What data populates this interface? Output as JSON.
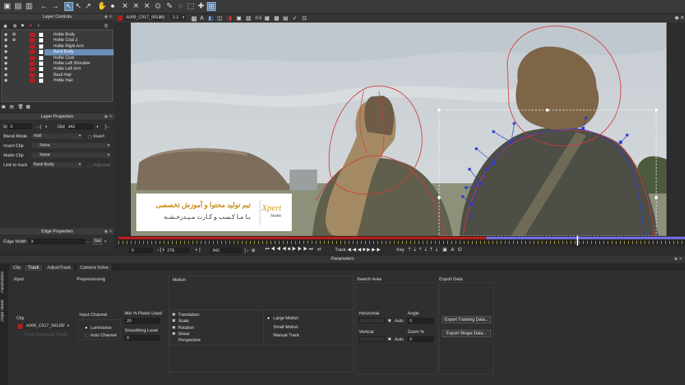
{
  "toolbar": {
    "clip_name": "A009_C017_09135I",
    "zoom": "1:1",
    "opacity": "0.5"
  },
  "layer_controls": {
    "title": "Layer Controls",
    "layers": [
      {
        "name": "Hollie Body",
        "selected": false
      },
      {
        "name": "Hollie Coat 2",
        "selected": false
      },
      {
        "name": "Hollie Right Arm",
        "selected": false
      },
      {
        "name": "Basil Body",
        "selected": true
      },
      {
        "name": "Hollie Coat",
        "selected": false
      },
      {
        "name": "Hollie Left Shoulder",
        "selected": false
      },
      {
        "name": "Hollie Left Arm",
        "selected": false
      },
      {
        "name": "Basil Hair",
        "selected": false
      },
      {
        "name": "Hollie Hair",
        "selected": false
      }
    ]
  },
  "layer_properties": {
    "title": "Layer Properties",
    "in_label": "In",
    "in_value": "0",
    "out_label": "Out",
    "out_value": "342",
    "blend_mode_label": "Blend Mode",
    "blend_mode_value": "Add",
    "invert_label": "Invert",
    "insert_clip_label": "Insert Clip",
    "insert_clip_value": "None",
    "matte_clip_label": "Matte Clip",
    "matte_clip_value": "None",
    "link_label": "Link to track",
    "link_value": "Basil Body",
    "adjusted_label": "Adjusted"
  },
  "edge_properties": {
    "title": "Edge Properties",
    "edge_width_label": "Edge Width",
    "edge_width_value": "3",
    "set_label": "Set"
  },
  "transport": {
    "start": "0",
    "current": "278",
    "end": "342",
    "track_label": "Track",
    "key_label": "Key"
  },
  "overlay": {
    "line1": "تیم تولید محتوا و آموزش تخصصی",
    "line2": "بـا مـا کـسب و کـارت مـیـدرخـشـه",
    "logo_text": "Xpert",
    "logo_sub": "Studio"
  },
  "parameters": {
    "title": "Parameters",
    "tabs": [
      "Clip",
      "Track",
      "AdjustTrack",
      "Camera Solve"
    ],
    "active_tab": "Track",
    "side_tabs": [
      "Parameters",
      "Dope Sheet"
    ],
    "input_label": "Input",
    "clip_label": "Clip",
    "clip_value": "A009_C017_09135f",
    "track_individual": "Track Individual Fields",
    "preprocessing_label": "Preprocessing",
    "input_channel_label": "Input Channel",
    "luminance": "Luminance",
    "auto_channel": "Auto Channel",
    "min_pixels_label": "Min % Pixels Used",
    "min_pixels_value": "20",
    "smoothing_label": "Smoothing Level",
    "smoothing_value": "0",
    "motion_label": "Motion",
    "motion_options": [
      "Translation",
      "Scale",
      "Rotation",
      "Shear",
      "Perspective"
    ],
    "motion_types": [
      "Large Motion",
      "Small Motion",
      "Manual Track"
    ],
    "search_area_label": "Search Area",
    "horizontal_label": "Horizontal",
    "vertical_label": "Vertical",
    "auto_label": "Auto",
    "angle_label": "Angle",
    "angle_value": "0",
    "zoom_label": "Zoom %",
    "zoom_value": "0",
    "export_data_label": "Export Data",
    "export_tracking": "Export Tracking Data...",
    "export_shape": "Export Shape Data..."
  }
}
